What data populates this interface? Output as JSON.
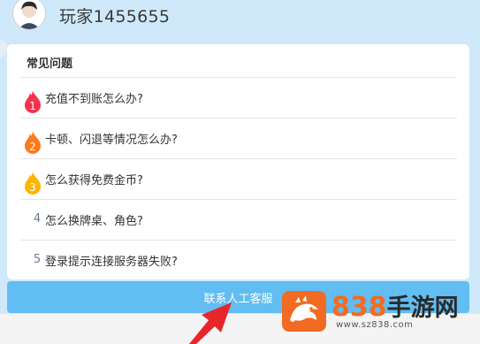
{
  "header": {
    "username": "玩家1455655"
  },
  "faq": {
    "title": "常见问题",
    "items": [
      {
        "num": "1",
        "text": "充值不到账怎么办?"
      },
      {
        "num": "2",
        "text": "卡顿、闪退等情况怎么办?"
      },
      {
        "num": "3",
        "text": "怎么获得免费金币?"
      },
      {
        "num": "4",
        "text": "怎么换牌桌、角色?"
      },
      {
        "num": "5",
        "text": "登录提示连接服务器失败?"
      }
    ]
  },
  "contact_button": {
    "label": "联系人工客服"
  },
  "watermark": {
    "brand_num": "838",
    "brand_cn": "手游网",
    "url": "www.sz838.com"
  },
  "colors": {
    "background": "#cfe9fb",
    "button": "#61bdf2",
    "rank1": "#f5334a",
    "rank2": "#ff7a1a",
    "rank3": "#ffb400",
    "arrow": "#e8262a"
  }
}
